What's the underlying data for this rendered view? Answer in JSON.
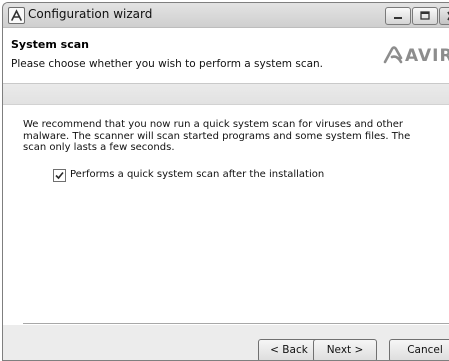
{
  "window": {
    "title": "Configuration wizard"
  },
  "header": {
    "title": "System scan",
    "subtitle": "Please choose whether you wish to perform a system scan.",
    "logo_text": "AVIRA"
  },
  "content": {
    "description": "We recommend that you now run a quick system scan for viruses and other malware. The scanner will scan started programs and some system files. The scan only lasts a few seconds.",
    "checkbox": {
      "label": "Performs a quick system scan after the installation",
      "checked": true
    }
  },
  "footer": {
    "back_label": "< Back",
    "next_label": "Next >",
    "cancel_label": "Cancel"
  },
  "colors": {
    "logo_gray": "#8d8d8d",
    "window_bg": "#ececec",
    "content_bg": "#ffffff"
  },
  "icons": {
    "app": "avira-logo-icon",
    "minimize": "minimize-icon",
    "maximize": "maximize-icon",
    "close": "close-icon",
    "checkmark": "checkmark-icon"
  }
}
